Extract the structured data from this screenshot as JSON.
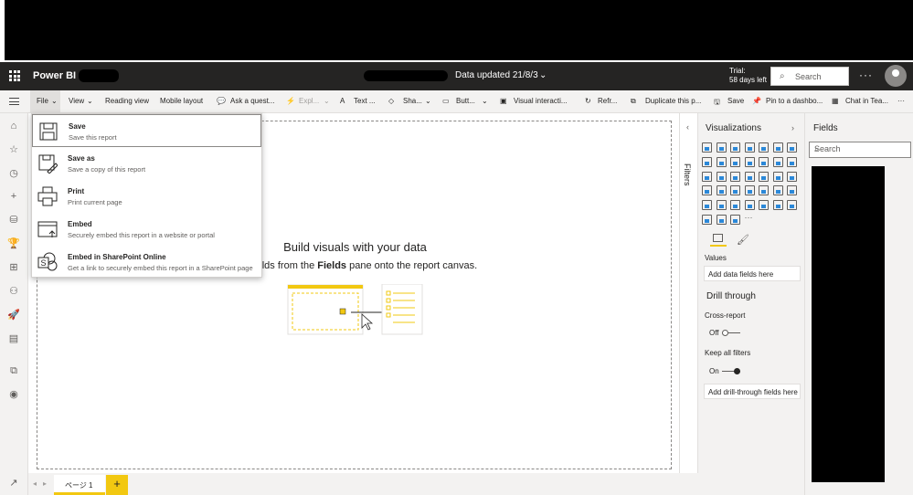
{
  "header": {
    "app_name": "Power BI",
    "data_updated": "Data updated 21/8/3",
    "trial_line1": "Trial:",
    "trial_line2": "58 days left",
    "search_placeholder": "Search",
    "more": "···"
  },
  "toolbar": {
    "file": "File",
    "view": "View",
    "reading_view": "Reading view",
    "mobile_layout": "Mobile layout",
    "ask_question": "Ask a quest...",
    "explore": "Expl...",
    "text_box": "Text ...",
    "shapes": "Sha...",
    "buttons": "Butt...",
    "visual_interactions": "Visual interacti...",
    "refresh": "Refr...",
    "duplicate": "Duplicate this p...",
    "save": "Save",
    "pin": "Pin to a dashbo...",
    "chat": "Chat in Tea...",
    "more": "···"
  },
  "file_menu": [
    {
      "title": "Save",
      "subtitle": "Save this report",
      "icon": "save-icon"
    },
    {
      "title": "Save as",
      "subtitle": "Save a copy of this report",
      "icon": "save-as-icon"
    },
    {
      "title": "Print",
      "subtitle": "Print current page",
      "icon": "print-icon"
    },
    {
      "title": "Embed",
      "subtitle": "Securely embed this report in a website or portal",
      "icon": "embed-icon"
    },
    {
      "title": "Embed in SharePoint Online",
      "subtitle": "Get a link to securely embed this report in a SharePoint page",
      "icon": "sharepoint-icon"
    }
  ],
  "canvas": {
    "heading": "Build visuals with your data",
    "instruction_pre": "ag fields from the ",
    "instruction_bold": "Fields",
    "instruction_post": " pane onto the report canvas."
  },
  "pages": {
    "tab_label": "ページ 1",
    "add": "+"
  },
  "filters_pane": {
    "label": "Filters"
  },
  "visualizations": {
    "title": "Visualizations",
    "values_label": "Values",
    "values_well": "Add data fields here",
    "drill_title": "Drill through",
    "cross_report": "Cross-report",
    "cross_report_state": "Off",
    "keep_filters": "Keep all filters",
    "keep_filters_state": "On",
    "drill_well": "Add drill-through fields here",
    "more": "···"
  },
  "fields_pane": {
    "title": "Fields",
    "search_placeholder": "Search"
  },
  "colors": {
    "accent": "#f2c811",
    "header_bg": "#252423",
    "pane_bg": "#f3f2f1"
  }
}
